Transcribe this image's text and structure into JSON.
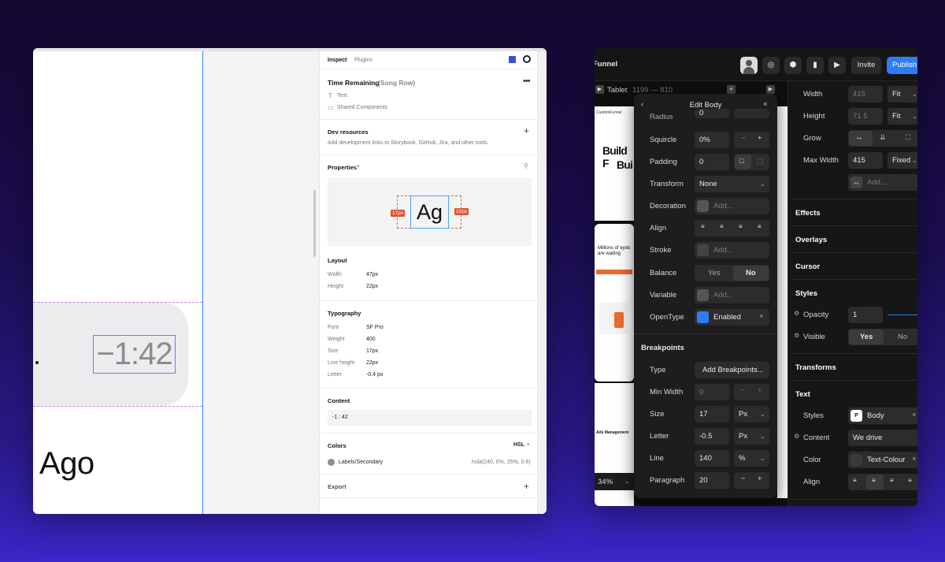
{
  "left": {
    "canvas": {
      "time": "−1:42",
      "ago": "Ago"
    },
    "tabs": [
      "Inspect",
      "Plugins"
    ],
    "component": {
      "name": "Time Remaining",
      "variant": "(Song Row)",
      "type": "Text",
      "library": "Shared Components"
    },
    "dev_resources": {
      "title": "Dev resources",
      "desc": "Add development links to Storybook, GitHub, Jira, and other tools."
    },
    "properties": {
      "title": "Properties",
      "sample": "Ag",
      "left_px": "17px",
      "right_px": "22px"
    },
    "layout": {
      "title": "Layout",
      "rows": [
        {
          "label": "Width",
          "value": "47px"
        },
        {
          "label": "Height",
          "value": "22px"
        }
      ]
    },
    "typography": {
      "title": "Typography",
      "rows": [
        {
          "label": "Font",
          "value": "SF Pro"
        },
        {
          "label": "Weight",
          "value": "400"
        },
        {
          "label": "Size",
          "value": "17px"
        },
        {
          "label": "Line height",
          "value": "22px"
        },
        {
          "label": "Letter",
          "value": "-0.4 px"
        }
      ]
    },
    "content": {
      "title": "Content",
      "value": "-1 : 42"
    },
    "colors": {
      "title": "Colors",
      "mode": "HSL",
      "name": "Labels/Secondary",
      "value": "hsla(240, 6%, 25%, 0.6)"
    },
    "export": {
      "title": "Export"
    }
  },
  "right": {
    "app_title": "Funnel",
    "invite": "Invite",
    "publish": "Publish",
    "canvas": {
      "breakpoint": "Tablet",
      "size": "1199 — 810",
      "brand": "CustomFunnel",
      "headline": "Build F",
      "headline2": "Bui",
      "card1": "Millions of eyeb are waiting",
      "ads": "Ads Management",
      "zoom": "34%"
    },
    "edit": {
      "title": "Edit Body",
      "rows": [
        {
          "label": "Radius",
          "value": "0"
        },
        {
          "label": "Squircle",
          "value": "0%"
        },
        {
          "label": "Padding",
          "value": "0"
        },
        {
          "label": "Transform",
          "value": "None"
        },
        {
          "label": "Decoration",
          "value": "Add..."
        },
        {
          "label": "Align",
          "value": ""
        },
        {
          "label": "Stroke",
          "value": "Add..."
        },
        {
          "label": "Balance",
          "value": ""
        },
        {
          "label": "Variable",
          "value": "Add..."
        },
        {
          "label": "OpenType",
          "value": "Enabled"
        }
      ],
      "balance": {
        "yes": "Yes",
        "no": "No"
      },
      "breakpoints_title": "Breakpoints",
      "bp_rows": [
        {
          "label": "Type",
          "value": "Add Breakpoints..."
        },
        {
          "label": "Min Width",
          "value": "0"
        },
        {
          "label": "Size",
          "value": "17",
          "unit": "Px"
        },
        {
          "label": "Letter",
          "value": "-0.5",
          "unit": "Px"
        },
        {
          "label": "Line",
          "value": "140",
          "unit": "%"
        },
        {
          "label": "Paragraph",
          "value": "20"
        }
      ]
    },
    "props": {
      "width": {
        "label": "Width",
        "value": "415",
        "mode": "Fit"
      },
      "height": {
        "label": "Height",
        "value": "71.5",
        "mode": "Fit"
      },
      "grow": {
        "label": "Grow"
      },
      "max_width": {
        "label": "Max Width",
        "value": "415",
        "mode": "Fixed"
      },
      "add": "Add...",
      "sections": [
        "Effects",
        "Overlays",
        "Cursor"
      ],
      "styles": {
        "title": "Styles",
        "opacity_label": "Opacity",
        "opacity": "1",
        "visible_label": "Visible",
        "yes": "Yes",
        "no": "No"
      },
      "transforms": "Transforms",
      "text": {
        "title": "Text",
        "styles_label": "Styles",
        "style": "Body",
        "content_label": "Content",
        "content": "We drive business...",
        "color_label": "Color",
        "color": "Text-Colour",
        "align_label": "Align"
      }
    }
  }
}
